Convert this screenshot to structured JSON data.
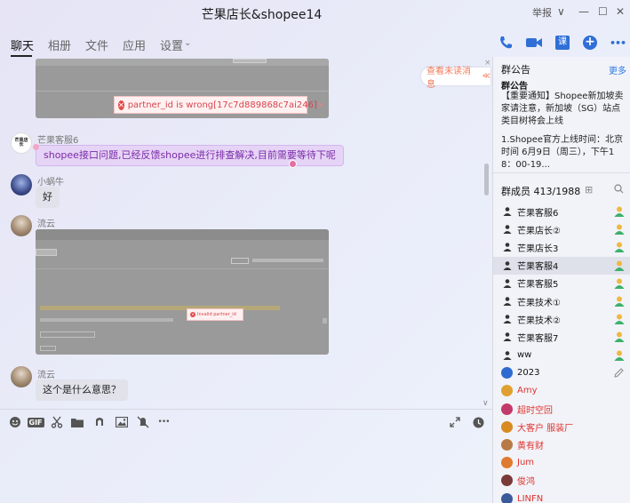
{
  "window": {
    "title": "芒果店长&shopee14",
    "report_label": "举报",
    "controls": {
      "dropdown": "∨",
      "minimize": "—",
      "maximize": "☐",
      "close": "✕"
    }
  },
  "tabs": [
    {
      "label": "聊天",
      "active": true
    },
    {
      "label": "相册",
      "active": false
    },
    {
      "label": "文件",
      "active": false
    },
    {
      "label": "应用",
      "active": false
    },
    {
      "label": "设置",
      "active": false
    }
  ],
  "toolbar_icons": [
    "phone-icon",
    "video-icon",
    "class-icon",
    "add-icon",
    "more-icon"
  ],
  "toolbar_glyphs": {
    "class": "课",
    "add": "+",
    "more": "•••"
  },
  "chat": {
    "unread_label": "查看未读消息",
    "unread_arrow": "≪",
    "messages": [
      {
        "type": "image",
        "error_text": "partner_id is wrong[17c7d889868c7ai246]"
      },
      {
        "sender": "芒果客服6",
        "text": "shopee接口问题,已经反馈shopee进行排查解决,目前需要等待下呢",
        "style": "purple"
      },
      {
        "sender": "小蜗牛",
        "text": "好",
        "style": "gray"
      },
      {
        "sender": "流云",
        "type": "image",
        "error_text": "Invalid partner_id"
      },
      {
        "sender": "流云",
        "text": "这个是什么意思？",
        "style": "gray"
      }
    ],
    "avatar_label": "芒果店长",
    "collapse_arrow": "∨"
  },
  "input_toolbar": [
    "emoji-icon",
    "gif-icon",
    "scissors-icon",
    "folder-icon",
    "music-icon",
    "image-icon",
    "mute-icon",
    "more-icon"
  ],
  "input_glyphs": {
    "gif": "GIF",
    "more": "•••"
  },
  "notice": {
    "header": "群公告",
    "more": "更多",
    "subtitle": "群公告",
    "body": "【重要通知】Shopee新加坡卖家请注意，新加坡（SG）站点类目树将会上线",
    "time": "1.Shopee官方上线时间：北京时间 6月9日（周三），下午18：00-19..."
  },
  "members": {
    "title": "群成员 413/1988",
    "add_glyph": "⊞",
    "list": [
      {
        "name": "芒果客服6",
        "role": "admin",
        "red": false
      },
      {
        "name": "芒果店长②",
        "role": "admin",
        "red": false
      },
      {
        "name": "芒果店长3",
        "role": "admin",
        "red": false
      },
      {
        "name": "芒果客服4",
        "role": "admin",
        "red": false,
        "selected": true
      },
      {
        "name": "芒果客服5",
        "role": "admin",
        "red": false
      },
      {
        "name": "芒果技术①",
        "role": "admin",
        "red": false
      },
      {
        "name": "芒果技术②",
        "role": "admin",
        "red": false
      },
      {
        "name": "芒果客服7",
        "role": "admin",
        "red": false
      },
      {
        "name": "ww",
        "role": "admin",
        "red": false
      },
      {
        "name": "2023",
        "role": "edit",
        "red": false
      },
      {
        "name": "Amy",
        "role": "",
        "red": true
      },
      {
        "name": "超时空回",
        "role": "",
        "red": true
      },
      {
        "name": "大客户 服装厂",
        "role": "",
        "red": true
      },
      {
        "name": "黄有财",
        "role": "",
        "red": true
      },
      {
        "name": "Jum",
        "role": "",
        "red": true
      },
      {
        "name": "俊鸿",
        "role": "",
        "red": true
      },
      {
        "name": "LINFN",
        "role": "",
        "red": true
      }
    ]
  },
  "colors": {
    "accent": "#2f7ae5",
    "error": "#d5454f",
    "warning": "#f07a5a",
    "purple_text": "#7a2aa8"
  }
}
